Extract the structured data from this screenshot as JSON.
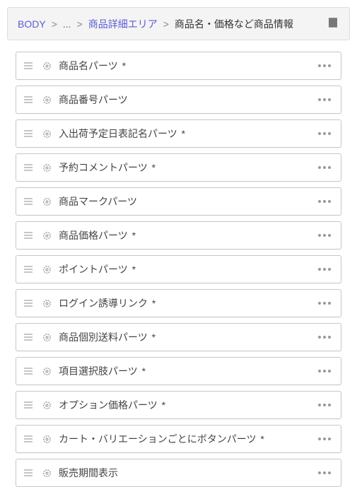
{
  "breadcrumb": {
    "root": "BODY",
    "sep": ">",
    "ellipsis": "...",
    "mid": "商品詳細エリア",
    "current": "商品名・価格など商品情報"
  },
  "parts": [
    {
      "label": "商品名パーツ",
      "required": true
    },
    {
      "label": "商品番号パーツ",
      "required": false
    },
    {
      "label": "入出荷予定日表記名パーツ",
      "required": true
    },
    {
      "label": "予約コメントパーツ",
      "required": true
    },
    {
      "label": "商品マークパーツ",
      "required": false
    },
    {
      "label": "商品価格パーツ",
      "required": true
    },
    {
      "label": "ポイントパーツ",
      "required": true
    },
    {
      "label": "ログイン誘導リンク",
      "required": true
    },
    {
      "label": "商品個別送料パーツ",
      "required": true
    },
    {
      "label": "項目選択肢パーツ",
      "required": true
    },
    {
      "label": "オプション価格パーツ",
      "required": true
    },
    {
      "label": "カート・バリエーションごとにボタンパーツ",
      "required": true
    },
    {
      "label": "販売期間表示",
      "required": false
    }
  ],
  "asterisk": "*"
}
